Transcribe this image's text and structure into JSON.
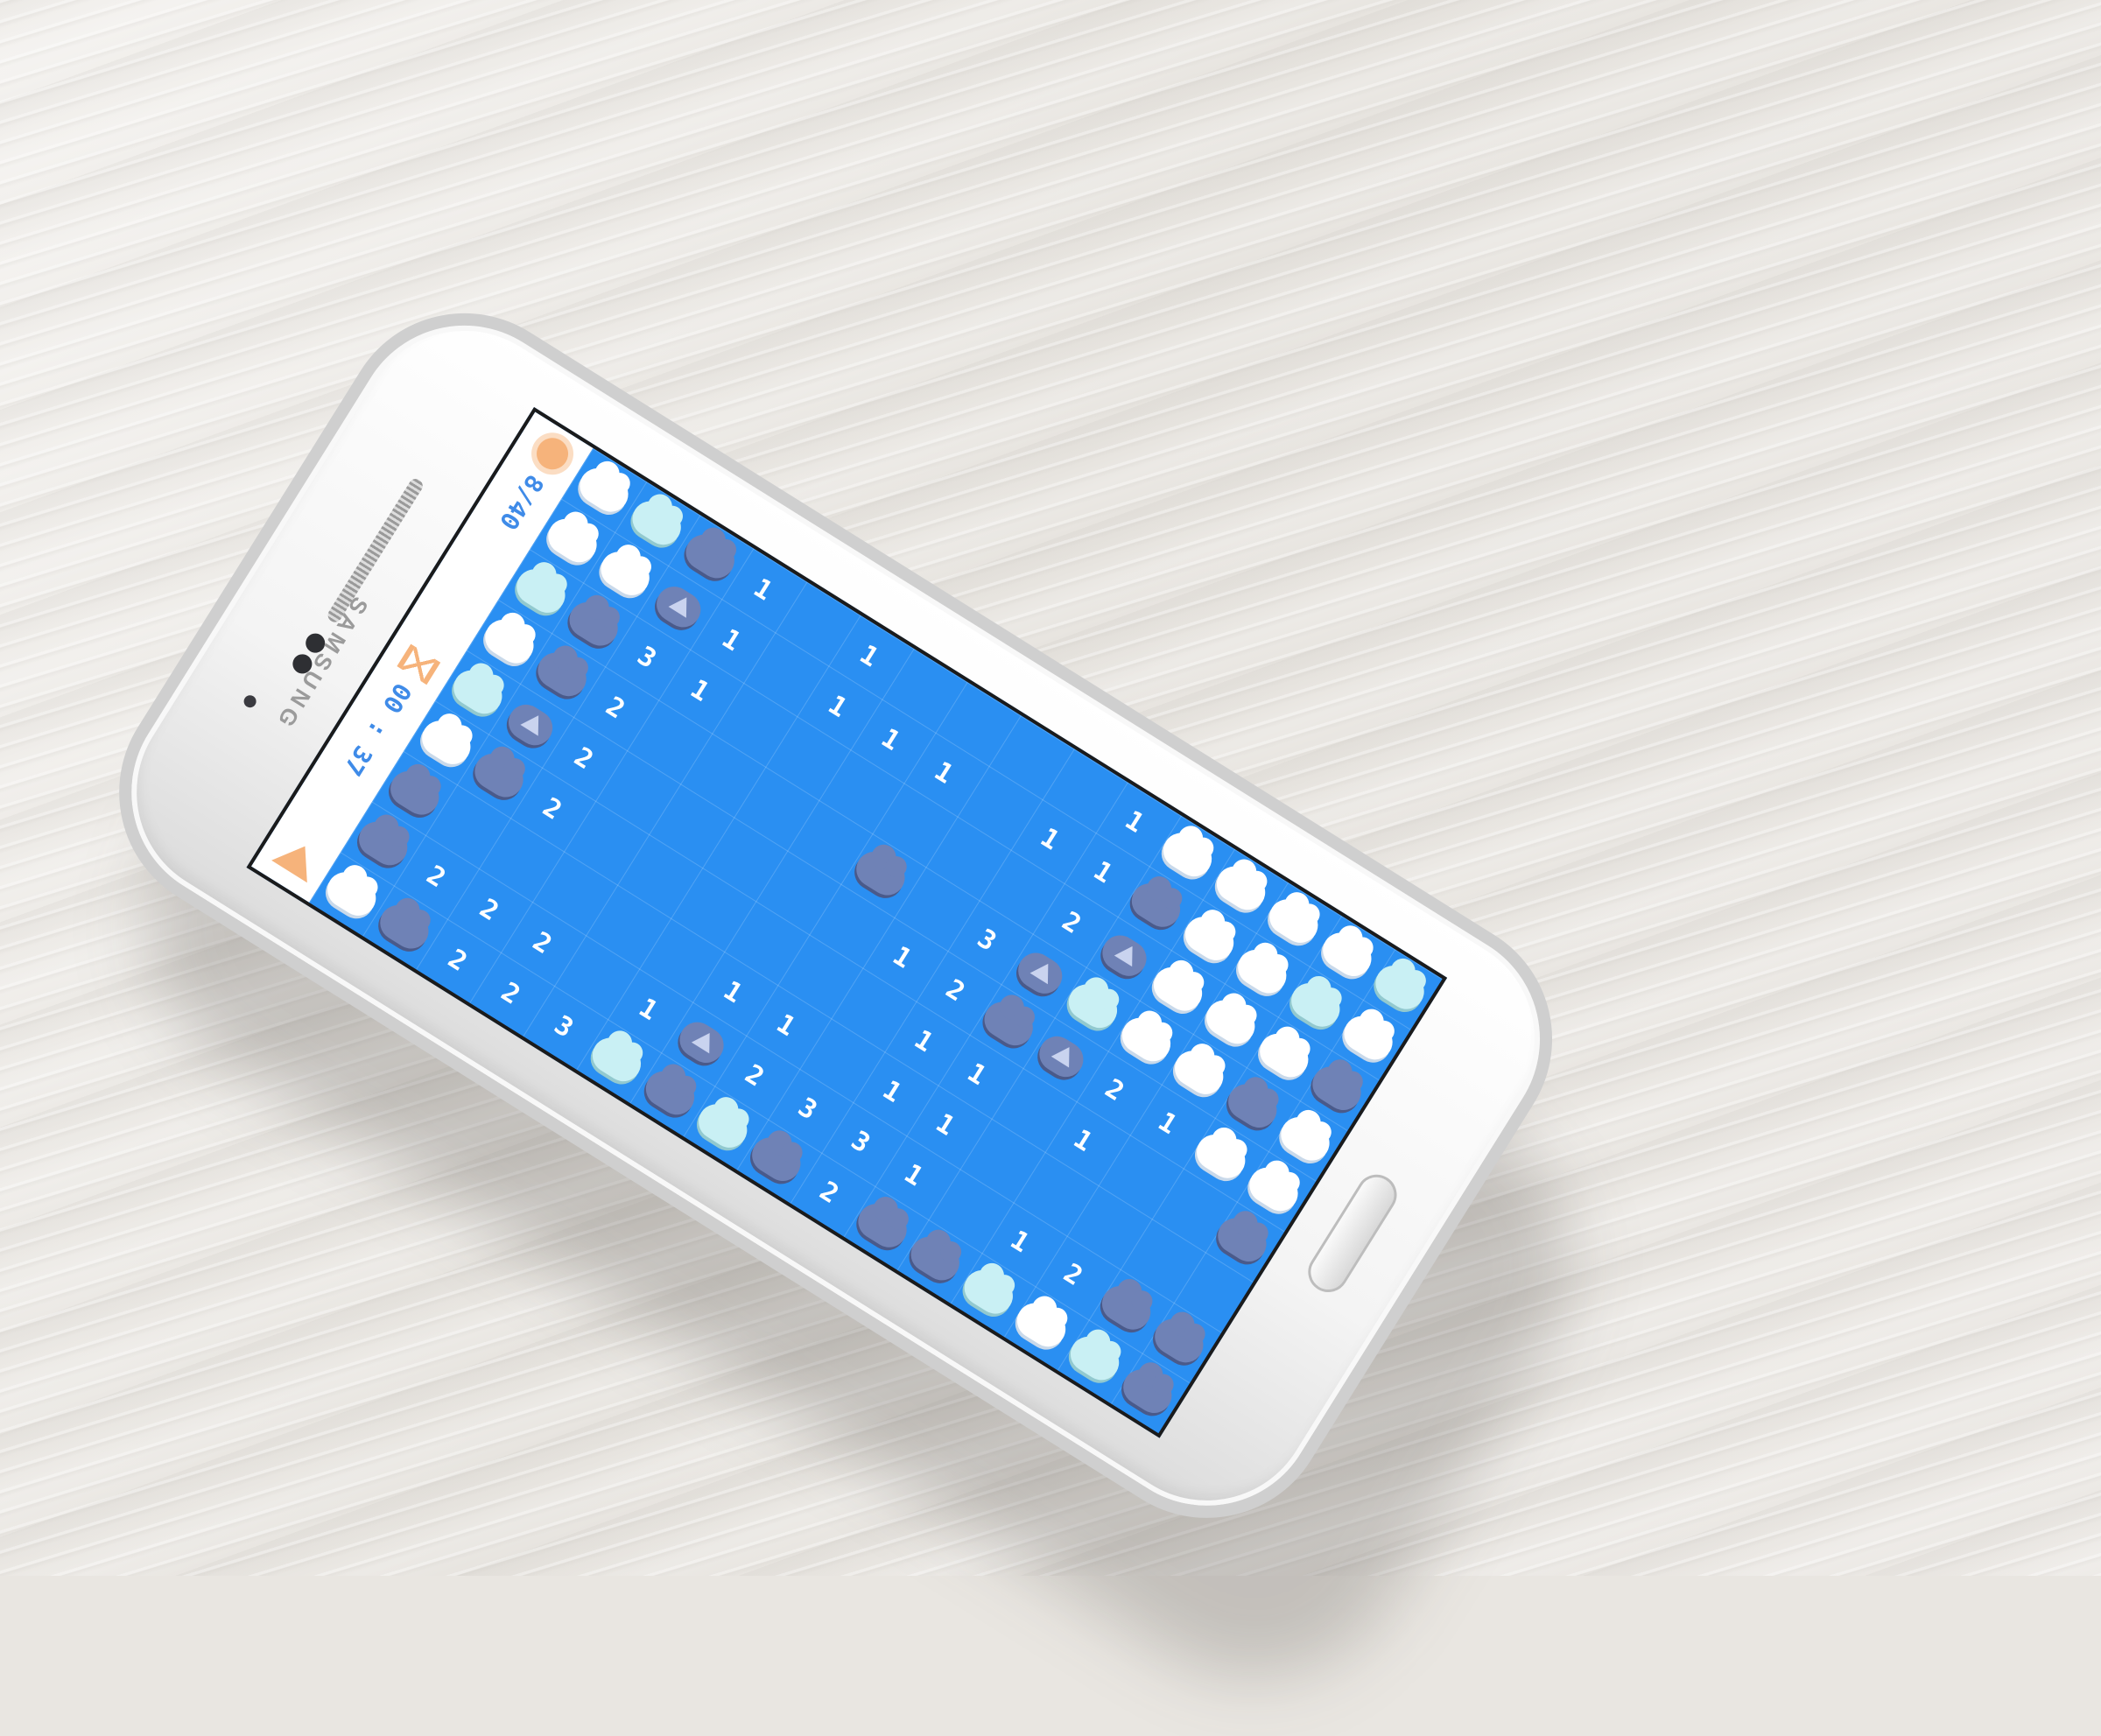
{
  "device": {
    "brand": "SAMSUNG"
  },
  "hud": {
    "mines": "8/40",
    "timer": "00 : 37"
  },
  "icons": {
    "mines": "sun-icon",
    "timer": "hourglass-icon",
    "back": "back-arrow-icon"
  },
  "colors": {
    "board": "#2a8ff2",
    "accent": "#f6b37b",
    "hud_text": "#3f8be8",
    "cloud": "#ffffff",
    "cloud_light": "#c9f0f4",
    "storm": "#6f82b6"
  },
  "board": {
    "rows": [
      [
        "C",
        "L",
        "S",
        "1",
        "",
        "1",
        "",
        "",
        "",
        "",
        "1",
        "C",
        "C",
        "C",
        "C",
        "L"
      ],
      [
        "C",
        "C",
        "F",
        "1",
        "",
        "1",
        "1",
        "1",
        "",
        "1",
        "1",
        "S",
        "C",
        "C",
        "L",
        "C"
      ],
      [
        "L",
        "S",
        "3",
        "1",
        "",
        "",
        "",
        "",
        "",
        "",
        "2",
        "F",
        "C",
        "C",
        "C",
        "S"
      ],
      [
        "C",
        "S",
        "2",
        "",
        "",
        "",
        "",
        "S",
        "",
        "3",
        "F",
        "L",
        "C",
        "C",
        "S",
        "C"
      ],
      [
        "L",
        "F",
        "2",
        "",
        "",
        "",
        "",
        "",
        "1",
        "2",
        "S",
        "F",
        "2",
        "1",
        "C",
        "C"
      ],
      [
        "C",
        "S",
        "2",
        "",
        "",
        "",
        "",
        "",
        "",
        "1",
        "1",
        "",
        "1",
        "",
        "",
        "S"
      ],
      [
        "S",
        "",
        "",
        "",
        "",
        "",
        "1",
        "1",
        "",
        "1",
        "1",
        "",
        "",
        "",
        "",
        ""
      ],
      [
        "S",
        "2",
        "2",
        "2",
        "",
        "1",
        "F",
        "2",
        "3",
        "3",
        "1",
        "",
        "1",
        "2",
        "S",
        "S"
      ],
      [
        "C",
        "S",
        "2",
        "2",
        "3",
        "L",
        "S",
        "L",
        "S",
        "2",
        "S",
        "S",
        "L",
        "C",
        "L",
        "S"
      ]
    ]
  }
}
